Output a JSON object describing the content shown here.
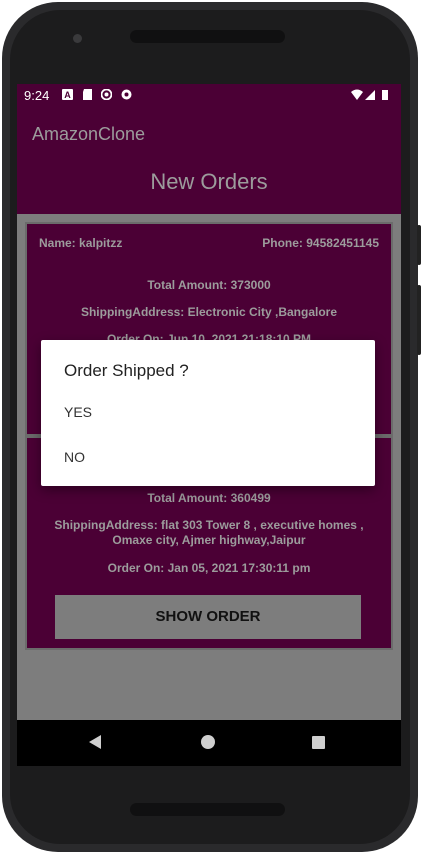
{
  "status_bar": {
    "time": "9:24"
  },
  "app": {
    "name": "AmazonClone",
    "page_title": "New Orders"
  },
  "orders": [
    {
      "name": "Name: kalpitzz",
      "phone": "Phone: 94582451145",
      "total": "Total Amount: 373000",
      "address": "ShippingAddress: Electronic City ,Bangalore",
      "order_on": "Order On: Jun 10, 2021 21:18:10 PM"
    },
    {
      "total": "Total Amount: 360499",
      "address_line1": "ShippingAddress: flat 303 Tower 8 , executive homes ,",
      "address_line2": "Omaxe city, Ajmer highway,Jaipur",
      "order_on": "Order On: Jan 05, 2021 17:30:11 pm",
      "button_label": "SHOW ORDER"
    }
  ],
  "dialog": {
    "title": "Order Shipped ?",
    "options": [
      "YES",
      "NO"
    ]
  },
  "colors": {
    "primary": "#4b0035",
    "scrim": "#7d7d7d"
  }
}
